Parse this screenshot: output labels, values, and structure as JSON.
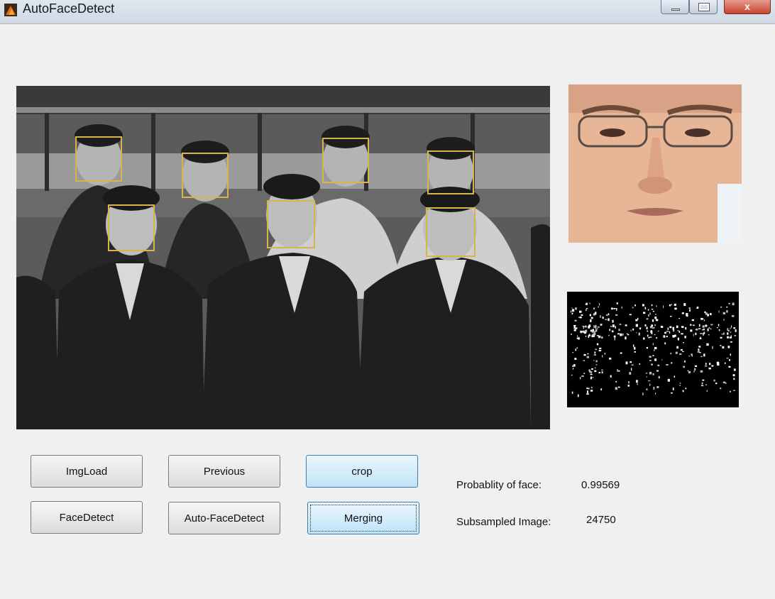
{
  "window": {
    "title": "AutoFaceDetect",
    "close_glyph": "x",
    "icons": [
      "matlab-app-icon",
      "minimize-icon",
      "maximize-icon",
      "close-icon"
    ]
  },
  "images": {
    "main_photo": "group-photo-grayscale-with-detected-faces",
    "face_crop": "cropped-face-color",
    "binary_map": "subsampled-binary-image"
  },
  "detections": {
    "count": 7,
    "box_color": "#d4b64a"
  },
  "buttons": {
    "imgload": "ImgLoad",
    "previous": "Previous",
    "crop": "crop",
    "facedetect": "FaceDetect",
    "autofacedetect": "Auto-FaceDetect",
    "merging": "Merging"
  },
  "results": {
    "probability_label": "Probablity of face:",
    "probability_value": "0.99569",
    "subsampled_label": "Subsampled Image:",
    "subsampled_value": "24750"
  },
  "colors": {
    "accent_button": "#bfe4f9",
    "background": "#f0f0f0"
  }
}
